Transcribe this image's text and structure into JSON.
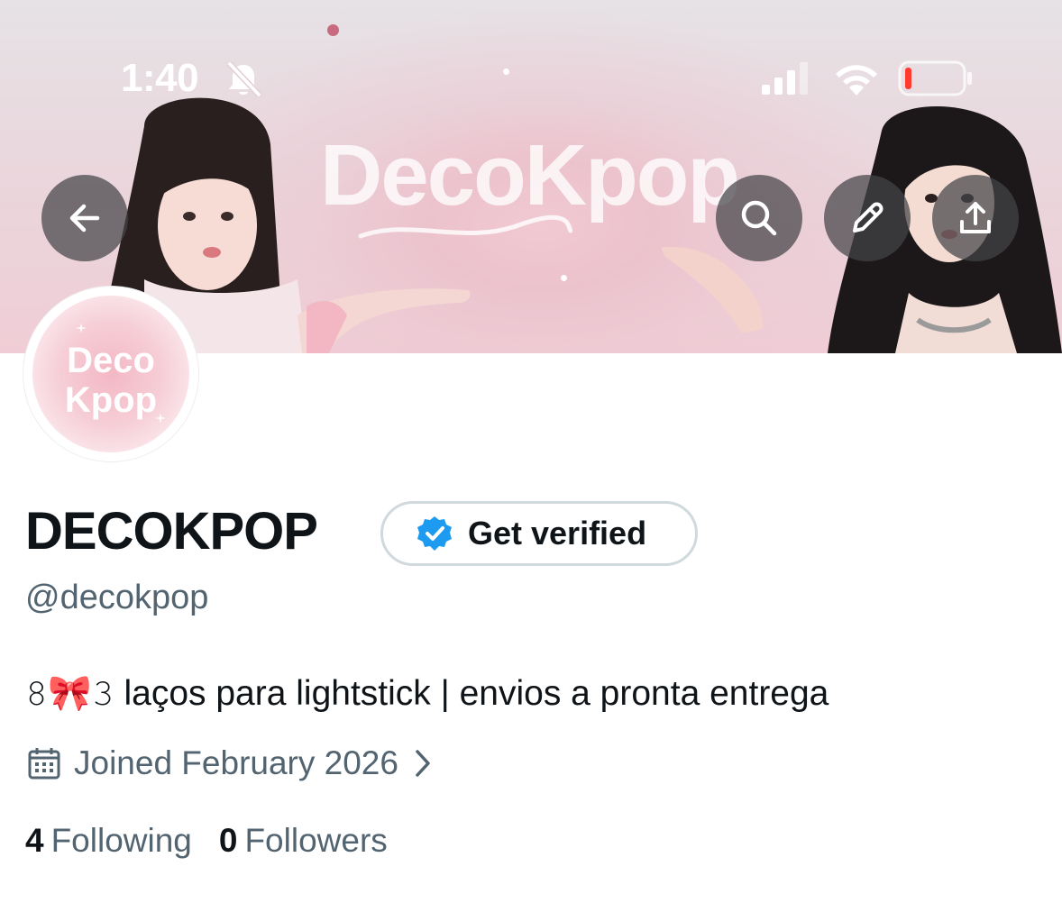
{
  "status_bar": {
    "time": "1:40",
    "silent_icon": "bell-slash-icon",
    "signal_icon": "cellular-signal-icon",
    "wifi_icon": "wifi-icon",
    "battery_icon": "battery-low-icon"
  },
  "header": {
    "banner_brand": "DecoKpop",
    "back_icon": "arrow-left-icon",
    "search_icon": "search-icon",
    "edit_icon": "pencil-icon",
    "share_icon": "share-upload-icon"
  },
  "profile": {
    "avatar_line1": "Deco",
    "avatar_line2": "Kpop",
    "display_name": "DECOKPOP",
    "verify_button": "Get verified",
    "handle": "@decokpop",
    "bio": "𝟾🎀𝟹 laços para lightstick | envios a pronta entrega",
    "joined": "Joined February 2026",
    "following_count": "4",
    "following_label": "Following",
    "followers_count": "0",
    "followers_label": "Followers"
  },
  "colors": {
    "accent": "#1d9bf0",
    "text_primary": "#0f1419",
    "text_secondary": "#536471",
    "banner_pink": "#f0cdd6",
    "battery_low": "#ff3b30"
  }
}
